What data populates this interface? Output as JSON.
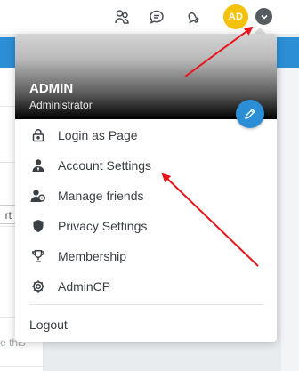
{
  "topbar": {
    "icons": [
      "friends-icon",
      "chat-icon",
      "bell-icon"
    ],
    "avatar_initials": "AD"
  },
  "background": {
    "sort_fragment": "rt by",
    "text_fragment": "e this"
  },
  "dropdown": {
    "user_name": "ADMIN",
    "user_role": "Administrator",
    "items": [
      {
        "label": "Login as Page",
        "icon": "lock-icon"
      },
      {
        "label": "Account Settings",
        "icon": "user-settings-icon"
      },
      {
        "label": "Manage friends",
        "icon": "manage-friends-icon"
      },
      {
        "label": "Privacy Settings",
        "icon": "shield-icon"
      },
      {
        "label": "Membership",
        "icon": "trophy-icon"
      },
      {
        "label": "AdminCP",
        "icon": "gear-icon"
      }
    ],
    "logout_label": "Logout"
  },
  "colors": {
    "accent": "#2c8fd6",
    "avatar": "#f4c20d",
    "annotation": "#e8141b"
  }
}
